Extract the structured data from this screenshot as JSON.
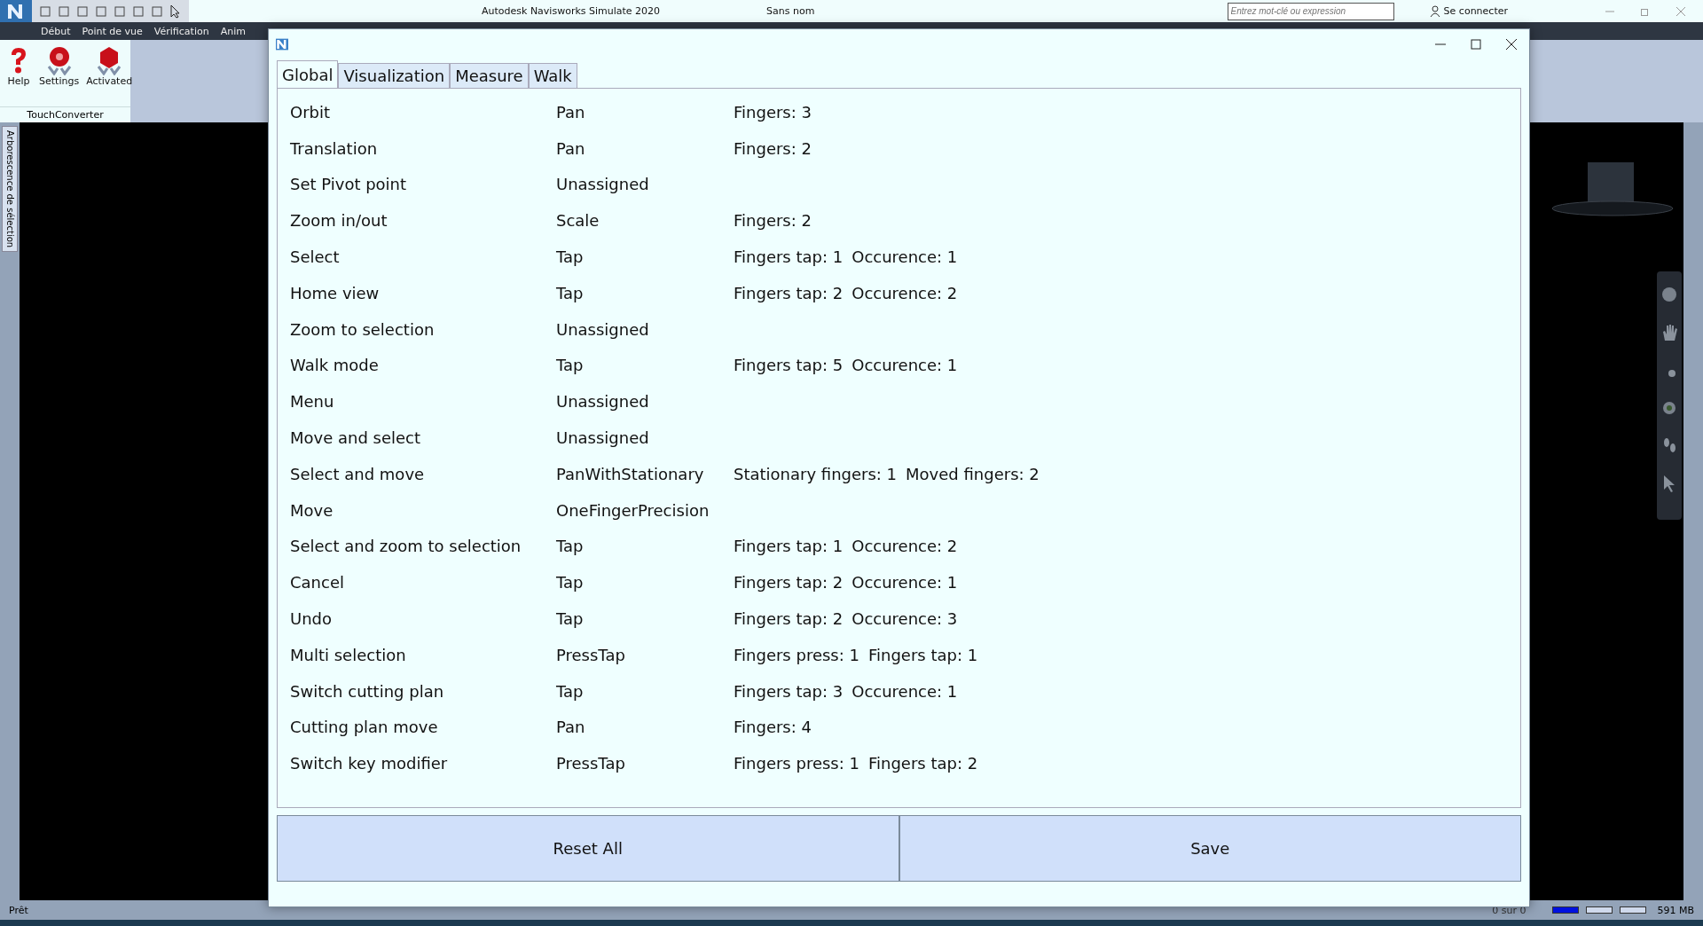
{
  "app": {
    "title": "Autodesk Navisworks Simulate 2020",
    "document": "Sans nom",
    "search": {
      "placeholder": "Entrez mot-clé ou expression"
    },
    "sign_in": "Se connecter",
    "menu": [
      {
        "label": "Début"
      },
      {
        "label": "Point de vue"
      },
      {
        "label": "Vérification"
      },
      {
        "label": "Anim"
      }
    ],
    "ribbon": {
      "buttons": [
        {
          "label": "Help",
          "kind": "help"
        },
        {
          "label": "Settings",
          "kind": "settings"
        },
        {
          "label": "Activated",
          "kind": "activated"
        }
      ],
      "panel_title": "TouchConverter"
    },
    "side_tab": "Arborescence de sélection",
    "status_bar": {
      "status": "Prêt",
      "page": "0 sur 0",
      "memory": "591 MB"
    }
  },
  "dialog": {
    "tabs": [
      {
        "label": "Global",
        "selected": true
      },
      {
        "label": "Visualization",
        "selected": false
      },
      {
        "label": "Measure",
        "selected": false
      },
      {
        "label": "Walk",
        "selected": false
      }
    ],
    "rows": [
      {
        "action": "Orbit",
        "gesture": "Pan",
        "params": [
          "Fingers: 3"
        ]
      },
      {
        "action": "Translation",
        "gesture": "Pan",
        "params": [
          "Fingers: 2"
        ]
      },
      {
        "action": "Set Pivot point",
        "gesture": "Unassigned",
        "params": []
      },
      {
        "action": "Zoom in/out",
        "gesture": "Scale",
        "params": [
          "Fingers: 2"
        ]
      },
      {
        "action": "Select",
        "gesture": "Tap",
        "params": [
          "Fingers tap: 1",
          "Occurence: 1"
        ]
      },
      {
        "action": "Home view",
        "gesture": "Tap",
        "params": [
          "Fingers tap: 2",
          "Occurence: 2"
        ]
      },
      {
        "action": "Zoom to selection",
        "gesture": "Unassigned",
        "params": []
      },
      {
        "action": "Walk mode",
        "gesture": "Tap",
        "params": [
          "Fingers tap: 5",
          "Occurence: 1"
        ]
      },
      {
        "action": "Menu",
        "gesture": "Unassigned",
        "params": []
      },
      {
        "action": "Move and select",
        "gesture": "Unassigned",
        "params": []
      },
      {
        "action": "Select and move",
        "gesture": "PanWithStationary",
        "params": [
          "Stationary fingers: 1",
          "Moved fingers: 2"
        ]
      },
      {
        "action": "Move",
        "gesture": "OneFingerPrecision",
        "params": []
      },
      {
        "action": "Select and zoom to selection",
        "gesture": "Tap",
        "params": [
          "Fingers tap: 1",
          "Occurence: 2"
        ]
      },
      {
        "action": "Cancel",
        "gesture": "Tap",
        "params": [
          "Fingers tap: 2",
          "Occurence: 1"
        ]
      },
      {
        "action": "Undo",
        "gesture": "Tap",
        "params": [
          "Fingers tap: 2",
          "Occurence: 3"
        ]
      },
      {
        "action": "Multi selection",
        "gesture": "PressTap",
        "params": [
          "Fingers press: 1",
          "Fingers tap: 1"
        ]
      },
      {
        "action": "Switch cutting plan",
        "gesture": "Tap",
        "params": [
          "Fingers tap: 3",
          "Occurence: 1"
        ]
      },
      {
        "action": "Cutting plan move",
        "gesture": "Pan",
        "params": [
          "Fingers: 4"
        ]
      },
      {
        "action": "Switch key modifier",
        "gesture": "PressTap",
        "params": [
          "Fingers press: 1",
          "Fingers tap: 2"
        ]
      }
    ],
    "buttons": [
      {
        "label": "Reset All"
      },
      {
        "label": "Save"
      }
    ]
  }
}
